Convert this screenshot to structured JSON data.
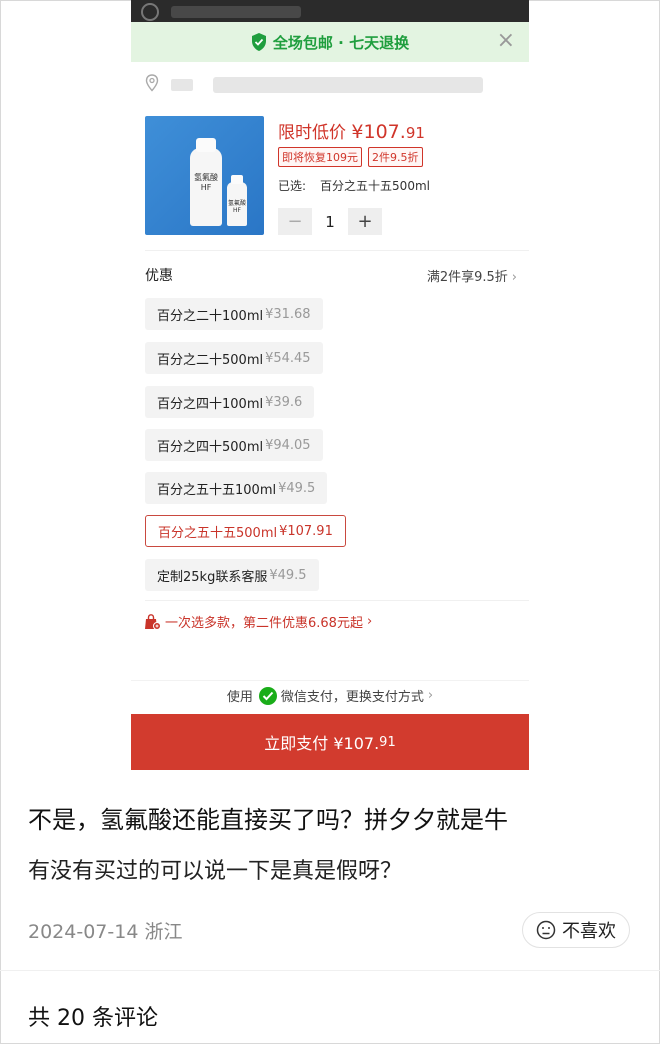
{
  "banner": {
    "text": "全场包邮 · 七天退换",
    "close": "×",
    "color": "#1f9e3e"
  },
  "product": {
    "image_label_big": "氢氟酸\nHF",
    "image_label_small": "氢氟酸\nHF",
    "price_prefix": "限时低价 ",
    "price_main": "¥107.",
    "price_decimal": "91",
    "tags": [
      "即将恢复109元",
      "2件9.5折"
    ],
    "selected_label": "已选:",
    "selected_value": "百分之五十五500ml",
    "minus": "−",
    "quantity": "1",
    "plus": "+"
  },
  "promo": {
    "title": "优惠",
    "right_text": "满2件享9.5折",
    "chevron": "›"
  },
  "options": [
    {
      "label": "百分之二十100ml",
      "price": "¥31.68",
      "active": false
    },
    {
      "label": "百分之二十500ml",
      "price": "¥54.45",
      "active": false
    },
    {
      "label": "百分之四十100ml",
      "price": "¥39.6",
      "active": false
    },
    {
      "label": "百分之四十500ml",
      "price": "¥94.05",
      "active": false
    },
    {
      "label": "百分之五十五100ml",
      "price": "¥49.5",
      "active": false
    },
    {
      "label": "百分之五十五500ml",
      "price": "¥107.91",
      "active": true
    },
    {
      "label": "定制25kg联系客服",
      "price": "¥49.5",
      "active": false
    }
  ],
  "multi_offer": {
    "text": "一次选多款，第二件优惠6.68元起",
    "chevron": "›"
  },
  "payment": {
    "prefix": "使用",
    "method": "微信支付，更换支付方式",
    "chevron": "›",
    "button_label": "立即支付 ¥107.",
    "button_decimal": "91",
    "accent": "#d23b2e"
  },
  "post": {
    "title": "不是，氢氟酸还能直接买了吗？拼夕夕就是牛",
    "subtitle": "有没有买过的可以说一下是真是假呀？",
    "date": "2024-07-14 浙江",
    "dislike": "不喜欢",
    "comment_count": "共 20 条评论"
  }
}
